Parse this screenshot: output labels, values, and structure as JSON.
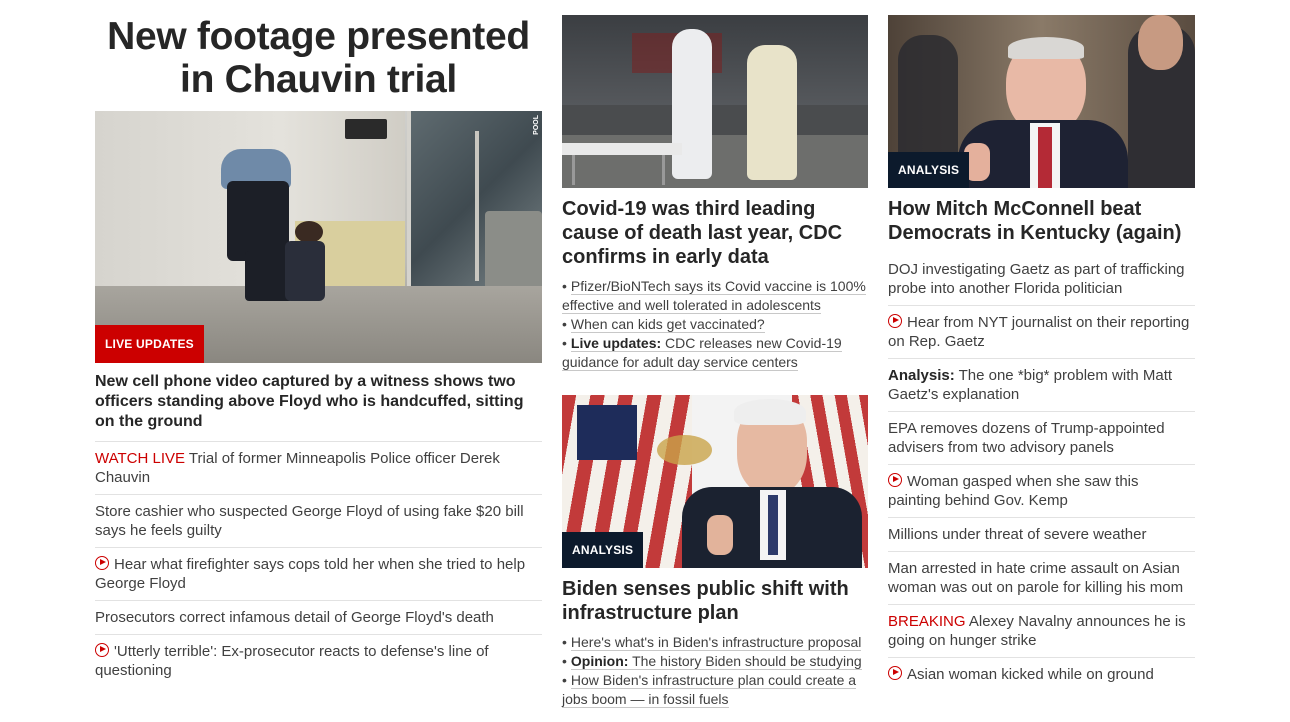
{
  "left": {
    "headline": "New footage presented in Chauvin trial",
    "hero_badge": "LIVE UPDATES",
    "hero_pool_tag": "POOL",
    "lead_description": "New cell phone video captured by a witness shows two officers standing above Floyd who is handcuffed, sitting on the ground",
    "stories": [
      {
        "prefix": "WATCH LIVE",
        "text": "Trial of former Minneapolis Police officer Derek Chauvin"
      },
      {
        "text": "Store cashier who suspected George Floyd of using fake $20 bill says he feels guilty"
      },
      {
        "icon": "play-icon",
        "text": "Hear what firefighter says cops told her when she tried to help George Floyd"
      },
      {
        "text": "Prosecutors correct infamous detail of George Floyd's death"
      },
      {
        "icon": "play-icon",
        "text": "'Utterly terrible': Ex-prosecutor reacts to defense's line of questioning"
      }
    ]
  },
  "middle": {
    "card1": {
      "headline": "Covid-19 was third leading cause of death last year, CDC confirms in early data",
      "bullets": [
        {
          "text": "Pfizer/BioNTech says its Covid vaccine is 100% effective and well tolerated in adolescents"
        },
        {
          "text": "When can kids get vaccinated?"
        },
        {
          "bold": "Live updates:",
          "text": "CDC releases new Covid-19 guidance for adult day service centers"
        }
      ]
    },
    "card2": {
      "badge": "ANALYSIS",
      "headline": "Biden senses public shift with infrastructure plan",
      "bullets": [
        {
          "text": "Here's what's in Biden's infrastructure proposal"
        },
        {
          "bold": "Opinion:",
          "text": "The history Biden should be studying"
        },
        {
          "text": "How Biden's infrastructure plan could create a jobs boom — in fossil fuels"
        }
      ]
    }
  },
  "right": {
    "badge": "ANALYSIS",
    "headline": "How Mitch McConnell beat Democrats in Kentucky (again)",
    "stories": [
      {
        "text": "DOJ investigating Gaetz as part of trafficking probe into another Florida politician"
      },
      {
        "icon": "play-icon",
        "text": "Hear from NYT journalist on their reporting on Rep. Gaetz"
      },
      {
        "bold": "Analysis:",
        "text": "The one *big* problem with Matt Gaetz's explanation"
      },
      {
        "text": "EPA removes dozens of Trump-appointed advisers from two advisory panels"
      },
      {
        "icon": "play-icon",
        "text": "Woman gasped when she saw this painting behind Gov. Kemp"
      },
      {
        "text": "Millions under threat of severe weather"
      },
      {
        "text": "Man arrested in hate crime assault on Asian woman was out on parole for killing his mom"
      },
      {
        "prefix": "BREAKING",
        "text": "Alexey Navalny announces he is going on hunger strike"
      },
      {
        "icon": "play-icon",
        "text": "Asian woman kicked while on ground"
      }
    ]
  },
  "colors": {
    "accent_red": "#cc0000",
    "badge_dark": "#0c1a2c",
    "text": "#262626",
    "divider": "#e2e2e2"
  }
}
